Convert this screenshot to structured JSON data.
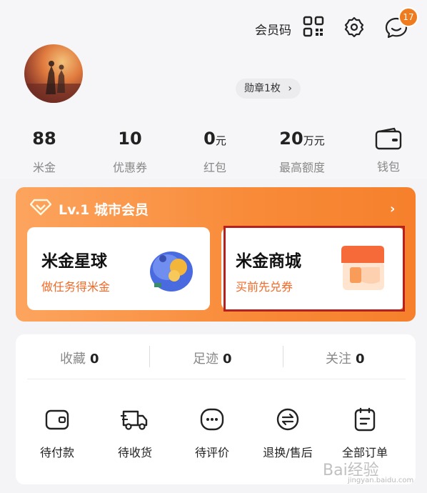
{
  "header": {
    "member_code_label": "会员码",
    "message_badge_count": "17",
    "medal_label": "勋章1枚",
    "medal_arrow": "›"
  },
  "stats": [
    {
      "value": "88",
      "unit": "",
      "label": "米金"
    },
    {
      "value": "10",
      "unit": "",
      "label": "优惠券"
    },
    {
      "value": "0",
      "unit": "元",
      "label": "红包"
    },
    {
      "value": "20",
      "unit": "万元",
      "label": "最高额度"
    },
    {
      "value": "",
      "unit": "",
      "label": "钱包"
    }
  ],
  "membership": {
    "title": "Lv.1 城市会员",
    "arrow": "›",
    "cards": [
      {
        "title": "米金星球",
        "desc": "做任务得米金"
      },
      {
        "title": "米金商城",
        "desc": "买前先兑券"
      }
    ]
  },
  "favorites": [
    {
      "label": "收藏",
      "count": "0"
    },
    {
      "label": "足迹",
      "count": "0"
    },
    {
      "label": "关注",
      "count": "0"
    }
  ],
  "orders": [
    {
      "label": "待付款"
    },
    {
      "label": "待收货"
    },
    {
      "label": "待评价"
    },
    {
      "label": "退换/售后"
    },
    {
      "label": "全部订单"
    }
  ],
  "watermark": {
    "text": "Bai经验",
    "url": "jingyan.baidu.com"
  },
  "colors": {
    "accent": "#f6802c",
    "badge": "#f07a1e",
    "highlight_border": "#b8201e"
  }
}
